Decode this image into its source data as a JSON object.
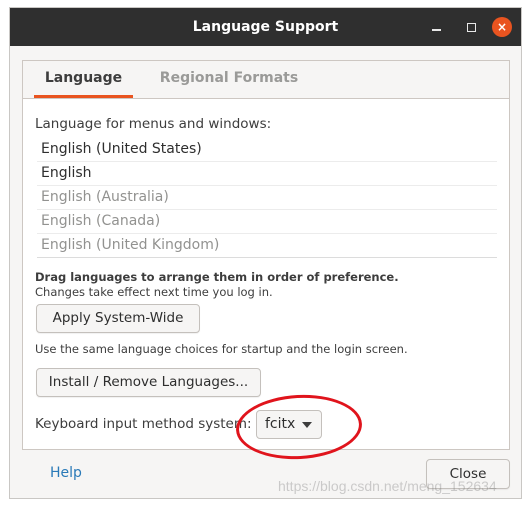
{
  "window": {
    "title": "Language Support",
    "close_glyph": "×"
  },
  "tabs": [
    {
      "label": "Language",
      "active": true
    },
    {
      "label": "Regional Formats",
      "active": false
    }
  ],
  "language": {
    "heading": "Language for menus and windows:",
    "items": [
      {
        "label": "English (United States)",
        "enabled": true
      },
      {
        "label": "English",
        "enabled": true
      },
      {
        "label": "English (Australia)",
        "enabled": false
      },
      {
        "label": "English (Canada)",
        "enabled": false
      },
      {
        "label": "English (United Kingdom)",
        "enabled": false
      }
    ],
    "hint_bold": "Drag languages to arrange them in order of preference.",
    "hint_normal": "Changes take effect next time you log in.",
    "apply_label": "Apply System-Wide",
    "same_choices_text": "Use the same language choices for startup and the login screen.",
    "install_label": "Install / Remove Languages...",
    "keyboard_label": "Keyboard input method system:",
    "keyboard_value": "fcitx"
  },
  "footer": {
    "help_label": "Help",
    "close_label": "Close"
  },
  "watermark": "https://blog.csdn.net/meng_152634",
  "colors": {
    "accent": "#e95420",
    "annotation": "#e0141c",
    "link": "#2a7ab8",
    "titlebar": "#2f2f2f"
  }
}
